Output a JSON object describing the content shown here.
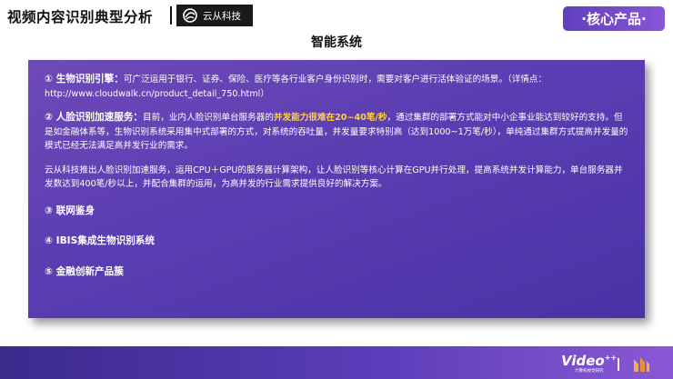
{
  "header": {
    "title": "视频内容识别典型分析",
    "logo_text": "云从科技",
    "badge": "·核心产品·"
  },
  "section_title": "智能系统",
  "panel": {
    "item1_heading": "① 生物识别引擎：",
    "item1_body": "可广泛运用于银行、证券、保险、医疗等各行业客户身份识别时，需要对客户进行活体验证的场景。（详情点：http://www.cloudwalk.cn/product_detail_750.html）",
    "item2_heading": "② 人脸识别加速服务：",
    "item2_body_a": "目前，业内人脸识别单台服务器的",
    "item2_highlight": "并发能力很难在20~40笔/秒",
    "item2_body_b": "，通过集群的部署方式能对中小企事业能达到较好的支持。但是如金融体系等，生物识别系统采用集中式部署的方式，对系统的吞吐量，并发量要求特别高（达到1000~1万笔/秒），单纯通过集群方式提高并发量的模式已经无法满足高并发行业的需求。",
    "item2_extra": "云从科技推出人脸识别加速服务，运用CPU＋GPU的服务器计算架构，让人脸识别等核心计算在GPU并行处理，提高系统并发计算能力，单台服务器并发数达到400笔/秒以上，并配合集群的运用，为高并发的行业需求提供良好的解决方案。",
    "item3": "③ 联网鉴身",
    "item4": "④ IBIS集成生物识别系统",
    "item5": "⑤ 金融创新产品簇"
  },
  "footer": {
    "video_logo": "Video",
    "video_plus": "++",
    "video_sub": "计算机视觉研究"
  },
  "colors": {
    "panel": "#5a3db2",
    "highlight": "#ffd23a",
    "badge": "#7a4fcf"
  }
}
